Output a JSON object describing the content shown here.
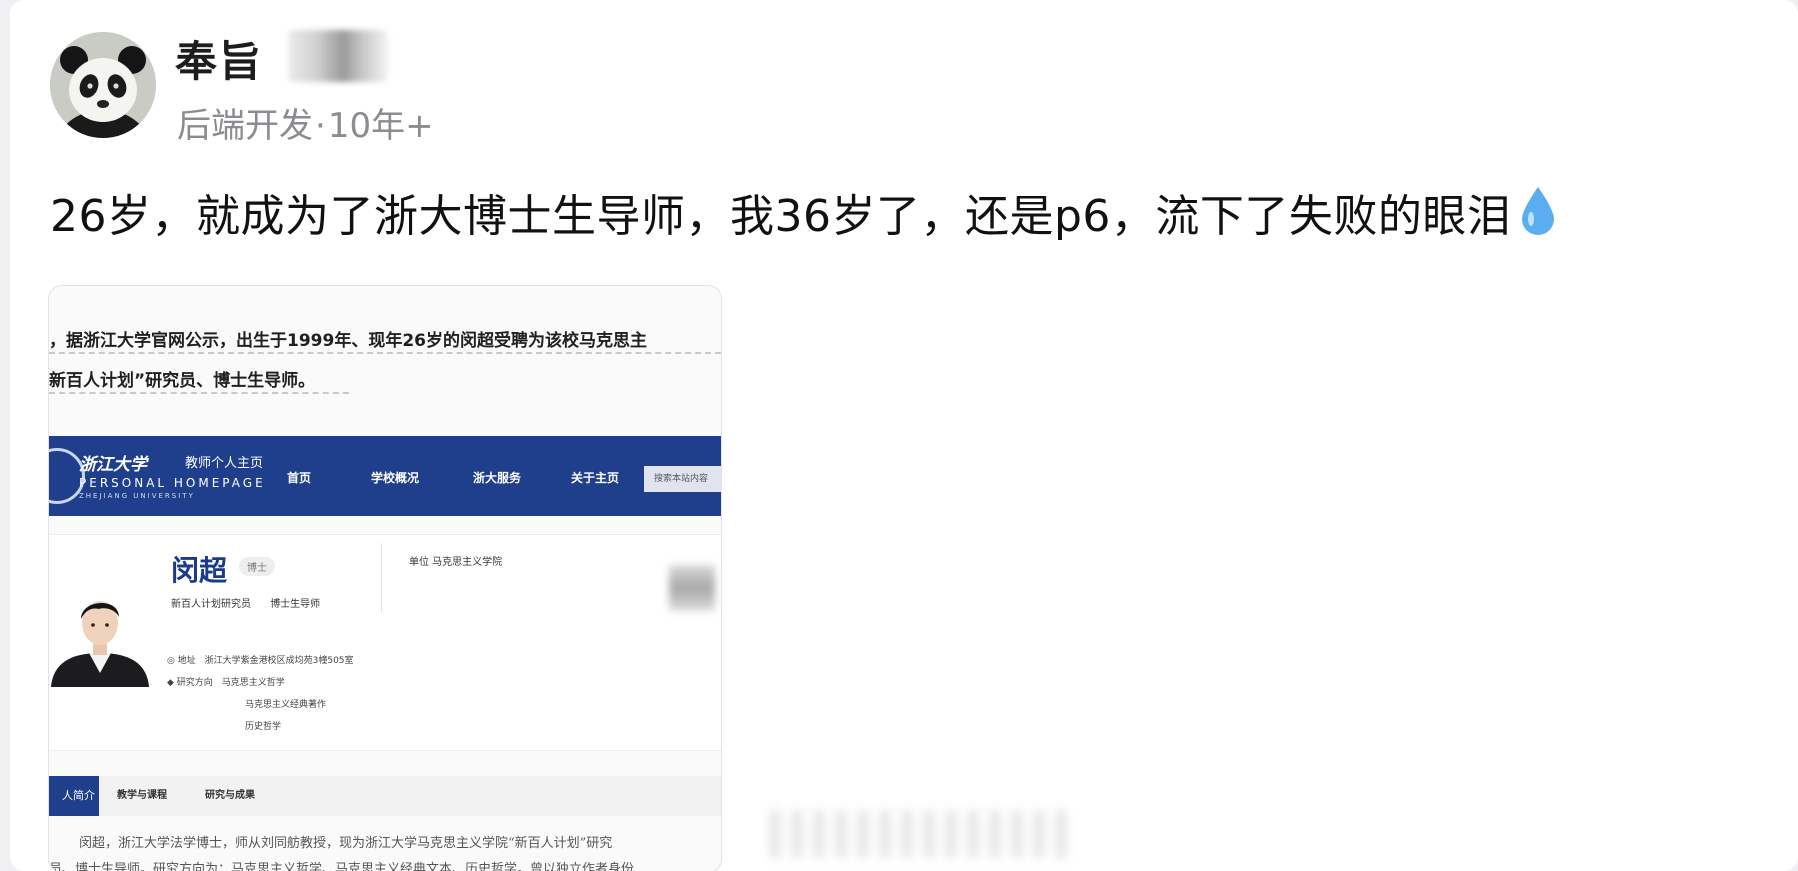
{
  "author": {
    "name_visible": "奉旨",
    "meta_role": "后端开发",
    "meta_sep": "·",
    "meta_years": "10年+",
    "avatar_icon": "panda-avatar-icon"
  },
  "post": {
    "text": "26岁，就成为了浙大博士生导师，我36岁了，还是p6，流下了失败的眼泪",
    "emoji": "droplet-icon"
  },
  "embedded_image": {
    "news_line1": "，据浙江大学官网公示，出生于1999年、现年26岁的闵超受聘为该校马克思主",
    "news_line2": "新百人计划”研究员、博士生导师。",
    "site": {
      "logo_text": "浙江大学",
      "subtitle": "教师个人主页",
      "english": "PERSONAL HOMEPAGE",
      "english_sub": "ZHEJIANG UNIVERSITY",
      "nav": [
        "首页",
        "学校概况",
        "浙大服务",
        "关于主页"
      ],
      "search": "搜索本站内容"
    },
    "profile": {
      "name": "闵超",
      "badge": "博士",
      "role1": "新百人计划研究员",
      "role2": "博士生导师",
      "unit": "单位  马克思主义学院",
      "address_label": "地址",
      "address": "浙江大学紫金港校区成均苑3幢505室",
      "research_label": "研究方向",
      "research": [
        "马克思主义哲学",
        "马克思主义经典著作",
        "历史哲学"
      ]
    },
    "tabs": [
      "人简介",
      "教学与课程",
      "研究与成果"
    ],
    "bio": [
      "闵超，浙江大学法学博士，师从刘同舫教授，现为浙江大学马克思主义学院“新百人计划”研究",
      "员、博士生导师。研究方向为：马克思主义哲学、马克思主义经典文本、历史哲学。曾以独立作者身份"
    ]
  },
  "colors": {
    "zju_blue": "#1f3f8d",
    "text": "#111111",
    "meta": "#8b8b90",
    "drop": "#5aaef0"
  }
}
